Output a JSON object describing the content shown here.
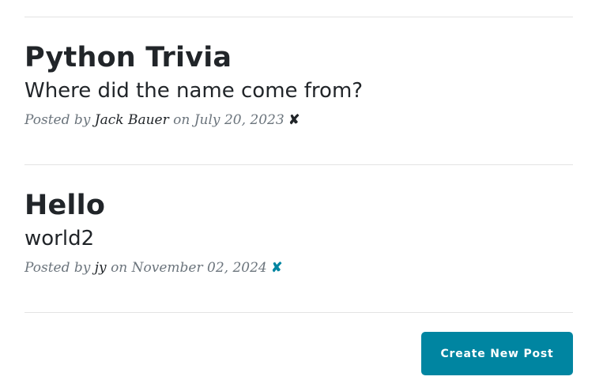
{
  "posts": [
    {
      "title": "Python Trivia",
      "subtitle": "Where did the name come from?",
      "meta_prefix": "Posted by",
      "author": "Jack Bauer",
      "meta_on": "on",
      "date": "July 20, 2023",
      "delete_glyph": "✘",
      "delete_color": "#212529"
    },
    {
      "title": "Hello",
      "subtitle": "world2",
      "meta_prefix": "Posted by",
      "author": "jy",
      "meta_on": "on",
      "date": "November 02, 2024",
      "delete_glyph": "✘",
      "delete_color": "#0085a1"
    }
  ],
  "create_button_label": "Create New Post",
  "colors": {
    "accent": "#0085a1",
    "text": "#212529",
    "muted": "#6c757d",
    "divider": "#e3e3e3"
  }
}
